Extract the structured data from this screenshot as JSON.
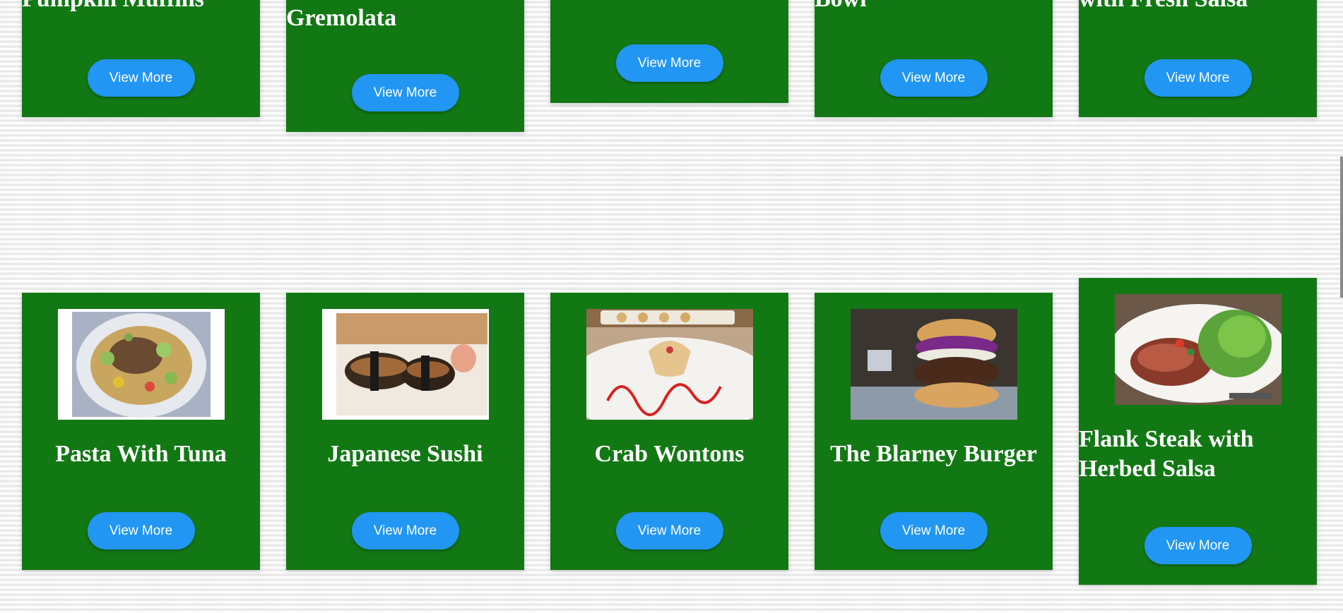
{
  "colors": {
    "card_bg": "#127814",
    "button_bg": "#2196f3",
    "title_text": "#ffffff",
    "page_bg": "#eeeeee"
  },
  "top_row": [
    {
      "title": "Pumpkin Muffins",
      "button": "View More"
    },
    {
      "title": "Gremolata",
      "button": "View More"
    },
    {
      "title": "",
      "button": "View More"
    },
    {
      "title": "Bowl",
      "button": "View More"
    },
    {
      "title": "with Fresh Salsa",
      "button": "View More"
    }
  ],
  "bottom_row": [
    {
      "title": "Pasta With Tuna",
      "button": "View More",
      "image": "pasta-with-tuna-photo"
    },
    {
      "title": "Japanese Sushi",
      "button": "View More",
      "image": "japanese-sushi-photo"
    },
    {
      "title": "Crab Wontons",
      "button": "View More",
      "image": "crab-wontons-photo"
    },
    {
      "title": "The Blarney Burger",
      "button": "View More",
      "image": "blarney-burger-photo"
    },
    {
      "title": "Flank Steak with Herbed Salsa",
      "button": "View More",
      "image": "flank-steak-photo"
    }
  ]
}
